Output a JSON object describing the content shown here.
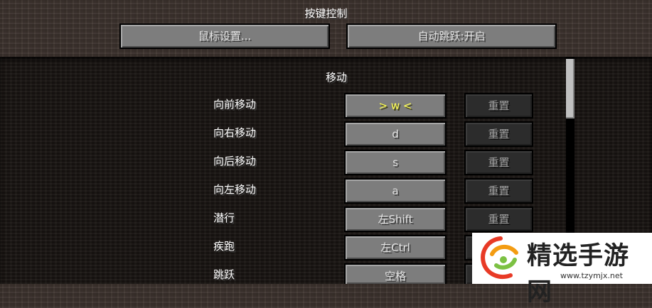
{
  "header": {
    "title": "按键控制",
    "mouse_settings_label": "鼠标设置...",
    "auto_jump_label": "自动跳跃:开启"
  },
  "section_title": "移动",
  "rows": [
    {
      "label": "向前移动",
      "key": "> w <",
      "reset": "重置"
    },
    {
      "label": "向右移动",
      "key": "d",
      "reset": "重置"
    },
    {
      "label": "向后移动",
      "key": "s",
      "reset": "重置"
    },
    {
      "label": "向左移动",
      "key": "a",
      "reset": "重置"
    },
    {
      "label": "潜行",
      "key": "左Shift",
      "reset": "重置"
    },
    {
      "label": "疾跑",
      "key": "左Ctrl",
      "reset": "重置"
    },
    {
      "label": "跳跃",
      "key": "空格",
      "reset": "重置"
    }
  ],
  "watermark": {
    "text": "精选手游网",
    "url": "www.tzymjx.net"
  },
  "colors": {
    "button_face": "#7d7d7d",
    "button_disabled": "#2c2c2c",
    "key_highlight": "#ffff55",
    "watermark_red": "#e83a26",
    "watermark_green": "#7cc143",
    "watermark_orange": "#f39c12"
  }
}
